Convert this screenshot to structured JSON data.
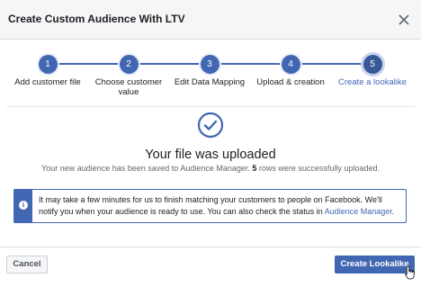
{
  "dialog": {
    "title": "Create Custom Audience With LTV",
    "close_icon": "close-icon"
  },
  "stepper": {
    "steps": [
      {
        "number": "1",
        "label": "Add customer file",
        "active": false
      },
      {
        "number": "2",
        "label": "Choose customer value",
        "active": false
      },
      {
        "number": "3",
        "label": "Edit Data Mapping",
        "active": false
      },
      {
        "number": "4",
        "label": "Upload & creation",
        "active": false
      },
      {
        "number": "5",
        "label": "Create a lookalike",
        "active": true
      }
    ]
  },
  "result": {
    "icon": "checkmark-circle-icon",
    "headline": "Your file was uploaded",
    "sub_prefix": "Your new audience has been saved to Audience Manager. ",
    "sub_rows": "5",
    "sub_suffix": " rows were successfully uploaded."
  },
  "info": {
    "icon": "info-icon",
    "text": "It may take a few minutes for us to finish matching your customers to people on Facebook. We'll notify you when your audience is ready to use. You can also check the status in ",
    "link": "Audience Manager",
    "trail": "."
  },
  "footer": {
    "cancel_label": "Cancel",
    "primary_label": "Create Lookalike"
  },
  "colors": {
    "accent": "#4267b2",
    "header_bg": "#f5f6f7"
  }
}
